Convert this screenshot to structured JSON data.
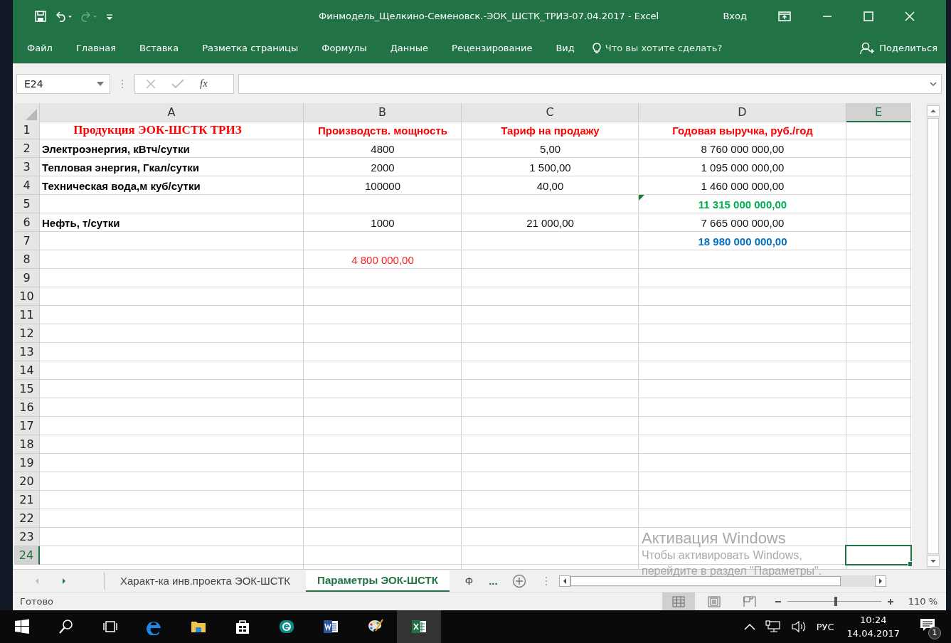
{
  "window": {
    "title": "Финмодель_Щелкино-Семеновск.-ЭОК_ШСТК_ТРИЗ-07.04.2017  -  Excel",
    "sign_in": "Вход"
  },
  "ribbon": {
    "tabs": [
      "Файл",
      "Главная",
      "Вставка",
      "Разметка страницы",
      "Формулы",
      "Данные",
      "Рецензирование",
      "Вид"
    ],
    "tell_me": "Что вы хотите сделать?",
    "share": "Поделиться"
  },
  "formula_bar": {
    "name_box": "E24",
    "function_label": "fx"
  },
  "sheet": {
    "columns": [
      {
        "label": "A",
        "selected": false
      },
      {
        "label": "B",
        "selected": false
      },
      {
        "label": "C",
        "selected": false
      },
      {
        "label": "D",
        "selected": false
      },
      {
        "label": "E",
        "selected": true
      }
    ],
    "rows": [
      {
        "number": "1",
        "selected": false,
        "cells": [
          {
            "text": "Продукция  ЭОК-ШСТК ТРИЗ",
            "kind": "title"
          },
          {
            "text": "Производств. мощность",
            "kind": "header"
          },
          {
            "text": "Тариф на продажу",
            "kind": "header"
          },
          {
            "text": "Годовая выручка, руб./год",
            "kind": "header"
          },
          null
        ]
      },
      {
        "number": "2",
        "selected": false,
        "cells": [
          {
            "text": "Электроэнергия, кВтч/сутки",
            "kind": "label"
          },
          {
            "text": "4800",
            "kind": "value"
          },
          {
            "text": "5,00",
            "kind": "value"
          },
          {
            "text": "8 760 000 000,00",
            "kind": "value"
          },
          null
        ]
      },
      {
        "number": "3",
        "selected": false,
        "cells": [
          {
            "text": "Тепловая энергия, Гкал/сутки",
            "kind": "label"
          },
          {
            "text": "2000",
            "kind": "value"
          },
          {
            "text": "1 500,00",
            "kind": "value"
          },
          {
            "text": "1 095 000 000,00",
            "kind": "value"
          },
          null
        ]
      },
      {
        "number": "4",
        "selected": false,
        "cells": [
          {
            "text": "Техническая вода,м куб/сутки",
            "kind": "label"
          },
          {
            "text": "100000",
            "kind": "value"
          },
          {
            "text": "40,00",
            "kind": "value"
          },
          {
            "text": "1 460 000 000,00",
            "kind": "value"
          },
          null
        ]
      },
      {
        "number": "5",
        "selected": false,
        "cells": [
          null,
          null,
          null,
          {
            "text": "11 315 000 000,00",
            "kind": "total_green",
            "error_flag": true
          },
          null
        ]
      },
      {
        "number": "6",
        "selected": false,
        "cells": [
          {
            "text": "Нефть, т/сутки",
            "kind": "label"
          },
          {
            "text": "1000",
            "kind": "value"
          },
          {
            "text": "21 000,00",
            "kind": "value"
          },
          {
            "text": "7 665 000 000,00",
            "kind": "value"
          },
          null
        ]
      },
      {
        "number": "7",
        "selected": false,
        "cells": [
          null,
          null,
          null,
          {
            "text": "18 980 000 000,00",
            "kind": "total_blue"
          },
          null
        ]
      },
      {
        "number": "8",
        "selected": false,
        "cells": [
          null,
          {
            "text": "4 800 000,00",
            "kind": "value_red"
          },
          null,
          null,
          null
        ]
      },
      {
        "number": "9",
        "selected": false
      },
      {
        "number": "10",
        "selected": false
      },
      {
        "number": "11",
        "selected": false
      },
      {
        "number": "12",
        "selected": false
      },
      {
        "number": "13",
        "selected": false
      },
      {
        "number": "14",
        "selected": false
      },
      {
        "number": "15",
        "selected": false
      },
      {
        "number": "16",
        "selected": false
      },
      {
        "number": "17",
        "selected": false
      },
      {
        "number": "18",
        "selected": false
      },
      {
        "number": "19",
        "selected": false
      },
      {
        "number": "20",
        "selected": false
      },
      {
        "number": "21",
        "selected": false
      },
      {
        "number": "22",
        "selected": false
      },
      {
        "number": "23",
        "selected": false
      },
      {
        "number": "24",
        "selected": true
      }
    ]
  },
  "sheet_tabs": {
    "tabs": [
      {
        "label": "Характ-ка инв.проекта ЭОК-ШСТК",
        "selected": false
      },
      {
        "label": "Параметры ЭОК-ШСТК",
        "selected": true
      },
      {
        "label": "Ф",
        "selected": false
      }
    ],
    "more": "..."
  },
  "activation_notice": {
    "title": "Активация Windows",
    "text": "Чтобы активировать Windows, перейдите в раздел \"Параметры\"."
  },
  "status_bar": {
    "status": "Готово",
    "views": [
      {
        "kind": "normal",
        "selected": true
      },
      {
        "kind": "page_layout",
        "selected": false
      },
      {
        "kind": "page_break",
        "selected": false
      }
    ],
    "zoom": {
      "level": 0.52,
      "reading": "110 %"
    }
  },
  "taskbar": {
    "apps": [
      {
        "kind": "edge",
        "active": false
      },
      {
        "kind": "explorer",
        "active": false
      },
      {
        "kind": "store",
        "active": false
      },
      {
        "kind": "eset",
        "active": false
      },
      {
        "kind": "word",
        "active": false
      },
      {
        "kind": "paint",
        "active": false
      },
      {
        "kind": "excel",
        "active": true
      }
    ],
    "language": "РУС",
    "time": "10:24",
    "date": "14.04.2017",
    "notifications": "1"
  }
}
